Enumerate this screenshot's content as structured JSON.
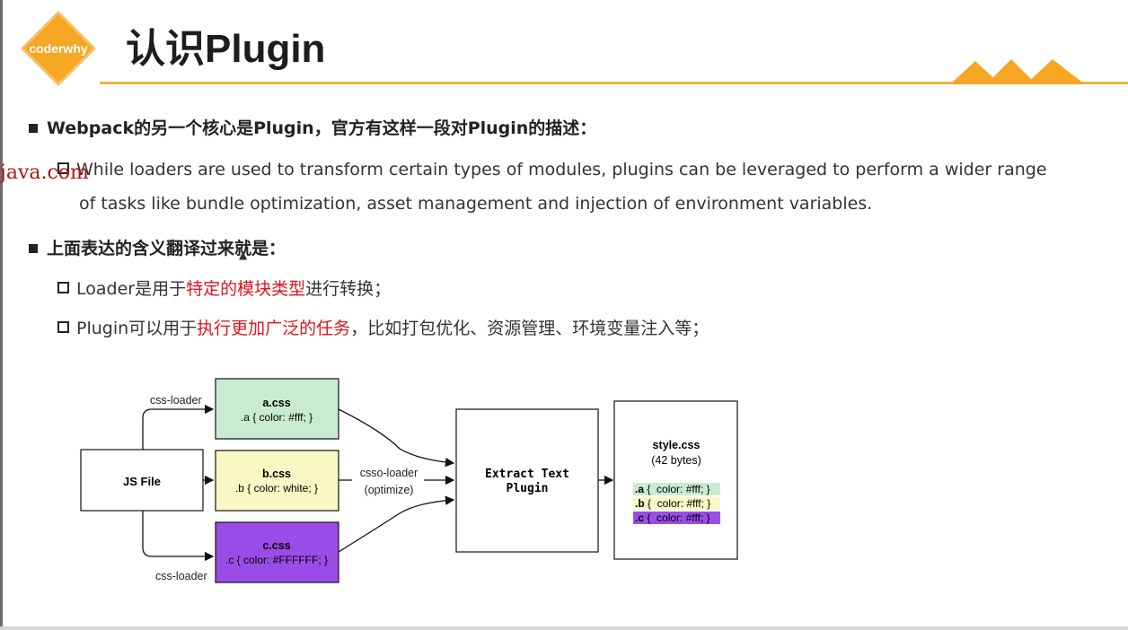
{
  "logo": {
    "text": "coderwhy",
    "color": "#f5a623"
  },
  "title": "认识Plugin",
  "watermark": "java.com",
  "bullets": [
    {
      "text": "Webpack的另一个核心是Plugin，官方有这样一段对Plugin的描述："
    },
    {
      "text": "上面表达的含义翻译过来就是："
    }
  ],
  "quote": {
    "line1": "While loaders are used to transform certain types of modules, plugins can be leveraged to perform a wider range",
    "line2": "of tasks like bundle optimization, asset management and injection of environment variables."
  },
  "loader_line": {
    "prefix": "Loader是用于",
    "highlight": "特定的模块类型",
    "suffix": "进行转换；"
  },
  "plugin_line": {
    "prefix": "Plugin可以用于",
    "highlight": "执行更加广泛的任务",
    "suffix": "，比如打包优化、资源管理、环境变量注入等；"
  },
  "diagram": {
    "js_file": "JS File",
    "css_loader_top": "css-loader",
    "css_loader_bottom": "css-loader",
    "csso_loader": "csso-loader",
    "optimize": "(optimize)",
    "a_css": {
      "name": "a.css",
      "code": ".a {  color: #fff; }",
      "color": "#c9ecd1"
    },
    "b_css": {
      "name": "b.css",
      "code": ".b {  color: white; }",
      "color": "#f9f8c4"
    },
    "c_css": {
      "name": "c.css",
      "code": ".c { color: #FFFFFF; }",
      "color": "#9a4ce8"
    },
    "extract": {
      "line1": "Extract Text",
      "line2": "Plugin"
    },
    "output": {
      "name": "style.css",
      "size": "(42 bytes)",
      "rules": [
        {
          "sel": ".a",
          "rest": " {  color: #fff; }",
          "color": "#c9ecd1"
        },
        {
          "sel": ".b",
          "rest": " {  color: #fff; }",
          "color": "#f9f8c4"
        },
        {
          "sel": ".c",
          "rest": " {  color: #fff; }",
          "color": "#9a4ce8"
        }
      ]
    }
  }
}
